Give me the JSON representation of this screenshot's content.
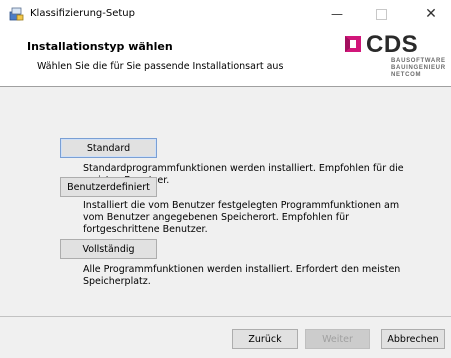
{
  "window": {
    "title": "Klassifizierung-Setup",
    "icon": "setup-icon",
    "controls": {
      "minimize": "—",
      "maximize": "□",
      "close": "✕"
    }
  },
  "header": {
    "title": "Installationstyp wählen",
    "subtitle": "Wählen Sie die für Sie passende Installationsart aus"
  },
  "logo": {
    "name": "CDS",
    "lines": [
      "BAUSOFTWARE",
      "BAUINGENIEUR",
      "NETCOM"
    ],
    "colors": {
      "mark": "#d1167a",
      "text": "#2a2a2a",
      "subtext": "#6b6b6b"
    }
  },
  "options": [
    {
      "label": "Standard",
      "description": "Standardprogrammfunktionen werden installiert. Empfohlen für die meisten Benutzer."
    },
    {
      "label": "Benutzerdefiniert",
      "description": "Installiert die vom Benutzer festgelegten Programmfunktionen am vom Benutzer angegebenen Speicherort. Empfohlen für fortgeschrittene Benutzer."
    },
    {
      "label": "Vollständig",
      "description": "Alle Programmfunktionen werden installiert. Erfordert den meisten Speicherplatz."
    }
  ],
  "footer": {
    "back": "Zurück",
    "next": "Weiter",
    "cancel": "Abbrechen"
  }
}
